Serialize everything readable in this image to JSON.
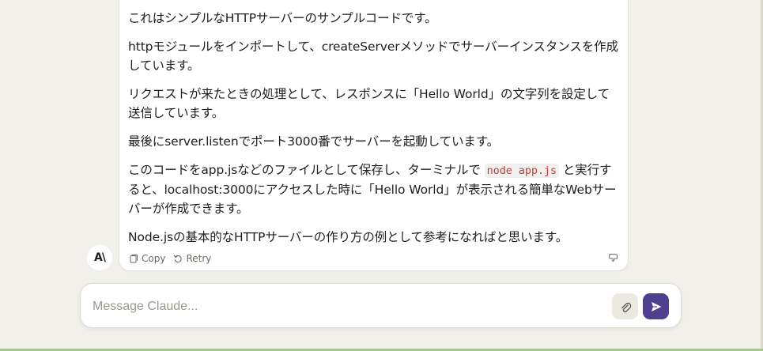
{
  "message": {
    "paragraphs": [
      "これはシンプルなHTTPサーバーのサンプルコードです。",
      "httpモジュールをインポートして、createServerメソッドでサーバーインスタンスを作成しています。",
      "リクエストが来たときの処理として、レスポンスに「Hello World」の文字列を設定して送信しています。",
      "最後にserver.listenでポート3000番でサーバーを起動しています。"
    ],
    "p5_before": "このコードをapp.jsなどのファイルとして保存し、ターミナルで ",
    "p5_code": "node app.js",
    "p5_after": " と実行すると、localhost:3000にアクセスした時に「Hello World」が表示される簡単なWebサーバーが作成できます。",
    "p6": "Node.jsの基本的なHTTPサーバーの作り方の例として参考になればと思います。"
  },
  "actions": {
    "copy_label": "Copy",
    "retry_label": "Retry"
  },
  "avatar": {
    "text": "A\\"
  },
  "composer": {
    "placeholder": "Message Claude..."
  },
  "colors": {
    "send_button": "#4f3f91",
    "code_text": "#c53c3c",
    "background": "#f2f0ea"
  },
  "icons": [
    "copy-icon",
    "retry-icon",
    "dislike-icon",
    "paperclip-icon",
    "send-icon"
  ]
}
